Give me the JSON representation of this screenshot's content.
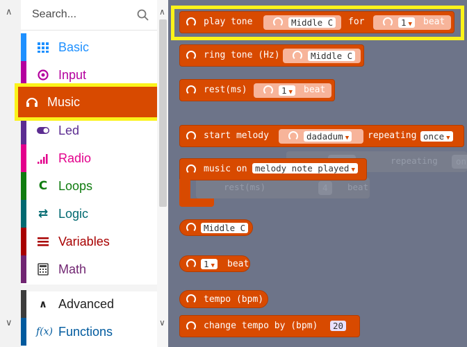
{
  "search": {
    "placeholder": "Search..."
  },
  "categories": [
    {
      "label": "Basic",
      "icon": "grid-icon",
      "color": "#1e90ff"
    },
    {
      "label": "Input",
      "icon": "target-icon",
      "color": "#b4009e"
    },
    {
      "label": "Music",
      "icon": "headphones-icon",
      "color": "#d84a00",
      "selected": true
    },
    {
      "label": "Led",
      "icon": "toggle-icon",
      "color": "#5c2d91"
    },
    {
      "label": "Radio",
      "icon": "signal-bars-icon",
      "color": "#e3008c"
    },
    {
      "label": "Loops",
      "icon": "loop-arrow-icon",
      "color": "#107c10"
    },
    {
      "label": "Logic",
      "icon": "shuffle-icon",
      "color": "#006970"
    },
    {
      "label": "Variables",
      "icon": "list-icon",
      "color": "#a80000"
    },
    {
      "label": "Math",
      "icon": "calculator-icon",
      "color": "#712672"
    },
    {
      "label": "Advanced",
      "icon": "chevron-up-icon",
      "color": "#3c3c3c"
    },
    {
      "label": "Functions",
      "icon": "function-icon",
      "color": "#005a9e"
    }
  ],
  "blocks": {
    "play_tone": {
      "label": "play tone",
      "note": "Middle C",
      "for_label": "for",
      "beats": "1",
      "beat_label": "beat"
    },
    "ring_tone": {
      "label": "ring tone (Hz)",
      "note": "Middle C"
    },
    "rest": {
      "label": "rest(ms)",
      "beats": "1",
      "beat_label": "beat"
    },
    "start_melody": {
      "label": "start melody",
      "melody": "dadadum",
      "repeating_label": "repeating",
      "repeat": "once"
    },
    "music_on": {
      "label": "music on",
      "event": "melody note played"
    },
    "note_value": {
      "note": "Middle C"
    },
    "beat_value": {
      "beats": "1",
      "beat_label": "beat"
    },
    "tempo": {
      "label": "tempo (bpm)"
    },
    "change_tempo": {
      "label": "change tempo by (bpm)",
      "value": "20"
    }
  },
  "ghost": {
    "repeating_label": "repeating",
    "repeat": "once",
    "rest_label": "rest(ms)",
    "beats": "4",
    "beat_label": "beat"
  },
  "colors": {
    "music": "#d84a00",
    "highlight": "#fbf31a",
    "flyout_bg": "#6d7489"
  }
}
